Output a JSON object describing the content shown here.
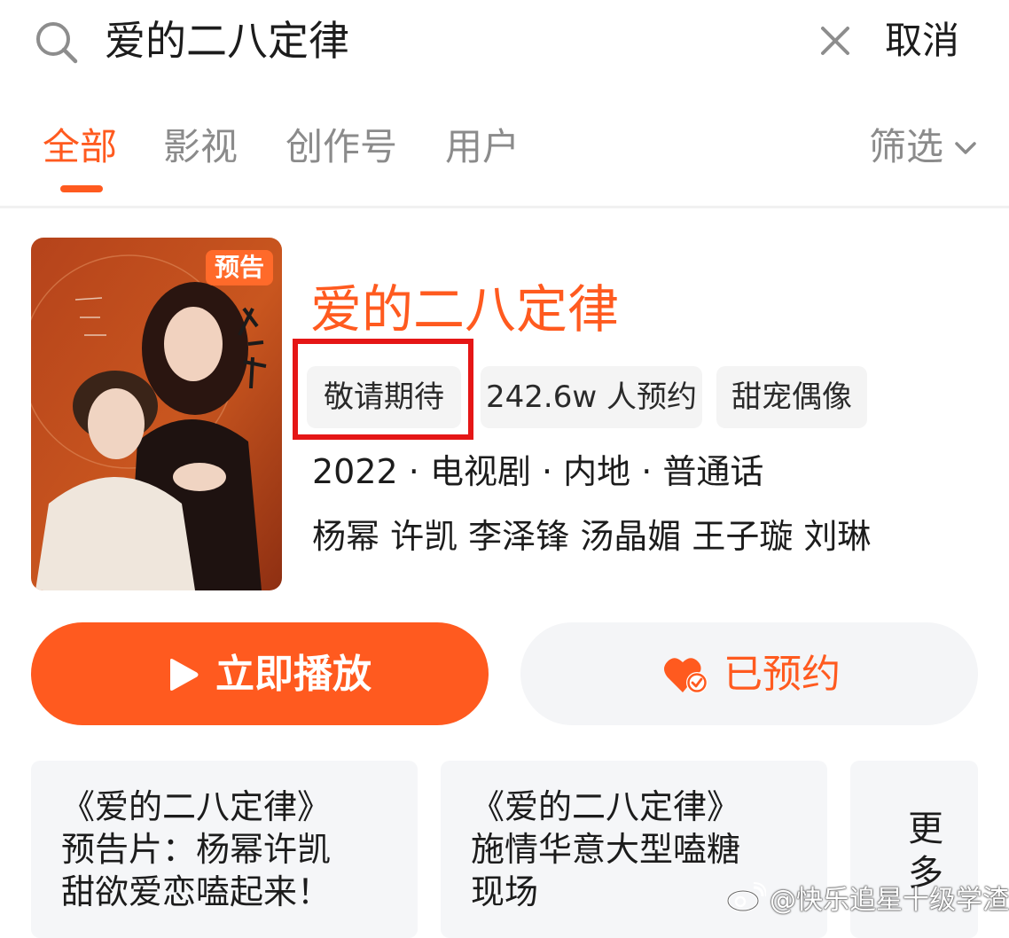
{
  "search": {
    "query": "爱的二八定律",
    "cancel_label": "取消"
  },
  "tabs": [
    {
      "label": "全部",
      "active": true
    },
    {
      "label": "影视",
      "active": false
    },
    {
      "label": "创作号",
      "active": false
    },
    {
      "label": "用户",
      "active": false
    }
  ],
  "filter_label": "筛选",
  "result": {
    "badge": "预告",
    "title": "爱的二八定律",
    "chips": [
      "敬请期待",
      "242.6w 人预约",
      "甜宠偶像"
    ],
    "meta": "2022 · 电视剧 · 内地 · 普通话",
    "cast": "杨幂 许凯 李泽锋 汤晶媚 王子璇 刘琳"
  },
  "actions": {
    "play_label": "立即播放",
    "reserve_label": "已预约"
  },
  "related": [
    {
      "lines": [
        "《爱的二八定律》",
        "预告片：杨幂许凯",
        "甜欲爱恋嗑起来！"
      ]
    },
    {
      "lines": [
        "《爱的二八定律》",
        "施情华意大型嗑糖",
        "现场"
      ]
    }
  ],
  "more_label": "更多",
  "watermark": "@快乐追星十级学渣",
  "colors": {
    "accent": "#ff5a1f",
    "highlight_box": "#e51616",
    "chip_bg": "#f4f4f4"
  },
  "icons": {
    "search": "search-icon",
    "clear": "close-icon",
    "filter": "chevron-down-icon",
    "play": "play-icon",
    "reserved": "heart-check-icon",
    "watermark": "weibo-icon"
  }
}
